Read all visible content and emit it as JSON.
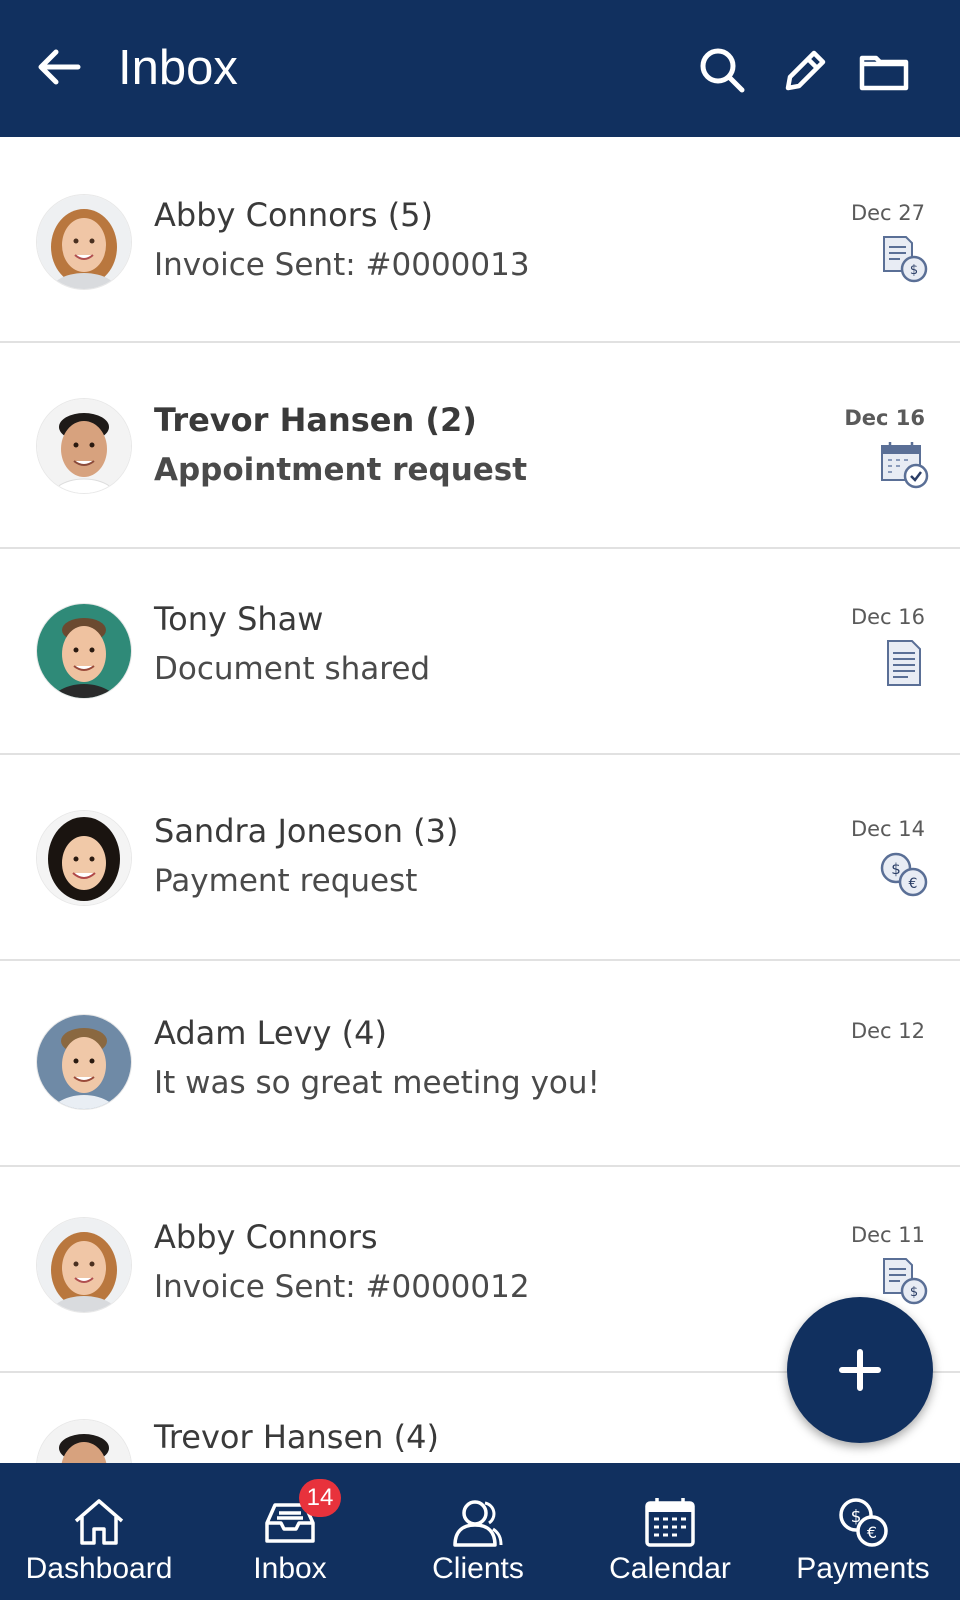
{
  "header": {
    "title": "Inbox",
    "bg_color": "#11305f",
    "icons": [
      "back-arrow-icon",
      "search-icon",
      "compose-pencil-icon",
      "folder-icon"
    ]
  },
  "messages": [
    {
      "name": "Abby Connors (5)",
      "preview": "Invoice Sent: #0000013",
      "date": "Dec 27",
      "type_icon": "invoice-icon",
      "unread": false
    },
    {
      "name": "Trevor Hansen (2)",
      "preview": "Appointment request",
      "date": "Dec 16",
      "type_icon": "calendar-check-icon",
      "unread": true
    },
    {
      "name": "Tony Shaw",
      "preview": "Document shared",
      "date": "Dec 16",
      "type_icon": "document-icon",
      "unread": false
    },
    {
      "name": "Sandra Joneson (3)",
      "preview": "Payment request",
      "date": "Dec 14",
      "type_icon": "coins-icon",
      "unread": false
    },
    {
      "name": "Adam Levy (4)",
      "preview": "It was so great meeting you!",
      "date": "Dec 12",
      "type_icon": "",
      "unread": false
    },
    {
      "name": "Abby Connors",
      "preview": "Invoice Sent: #0000012",
      "date": "Dec 11",
      "type_icon": "invoice-icon",
      "unread": false
    },
    {
      "name": "Trevor Hansen (4)",
      "preview": "",
      "date": "",
      "type_icon": "",
      "unread": false
    }
  ],
  "fab": {
    "icon": "plus-icon"
  },
  "bottom_nav": [
    {
      "label": "Dashboard",
      "icon": "house-icon"
    },
    {
      "label": "Inbox",
      "icon": "inbox-tray-icon",
      "badge": "14"
    },
    {
      "label": "Clients",
      "icon": "users-icon"
    },
    {
      "label": "Calendar",
      "icon": "calendar-icon"
    },
    {
      "label": "Payments",
      "icon": "coins-icon"
    }
  ],
  "colors": {
    "accent": "#11305f",
    "badge": "#e8323c",
    "divider": "#e1e1e1"
  }
}
